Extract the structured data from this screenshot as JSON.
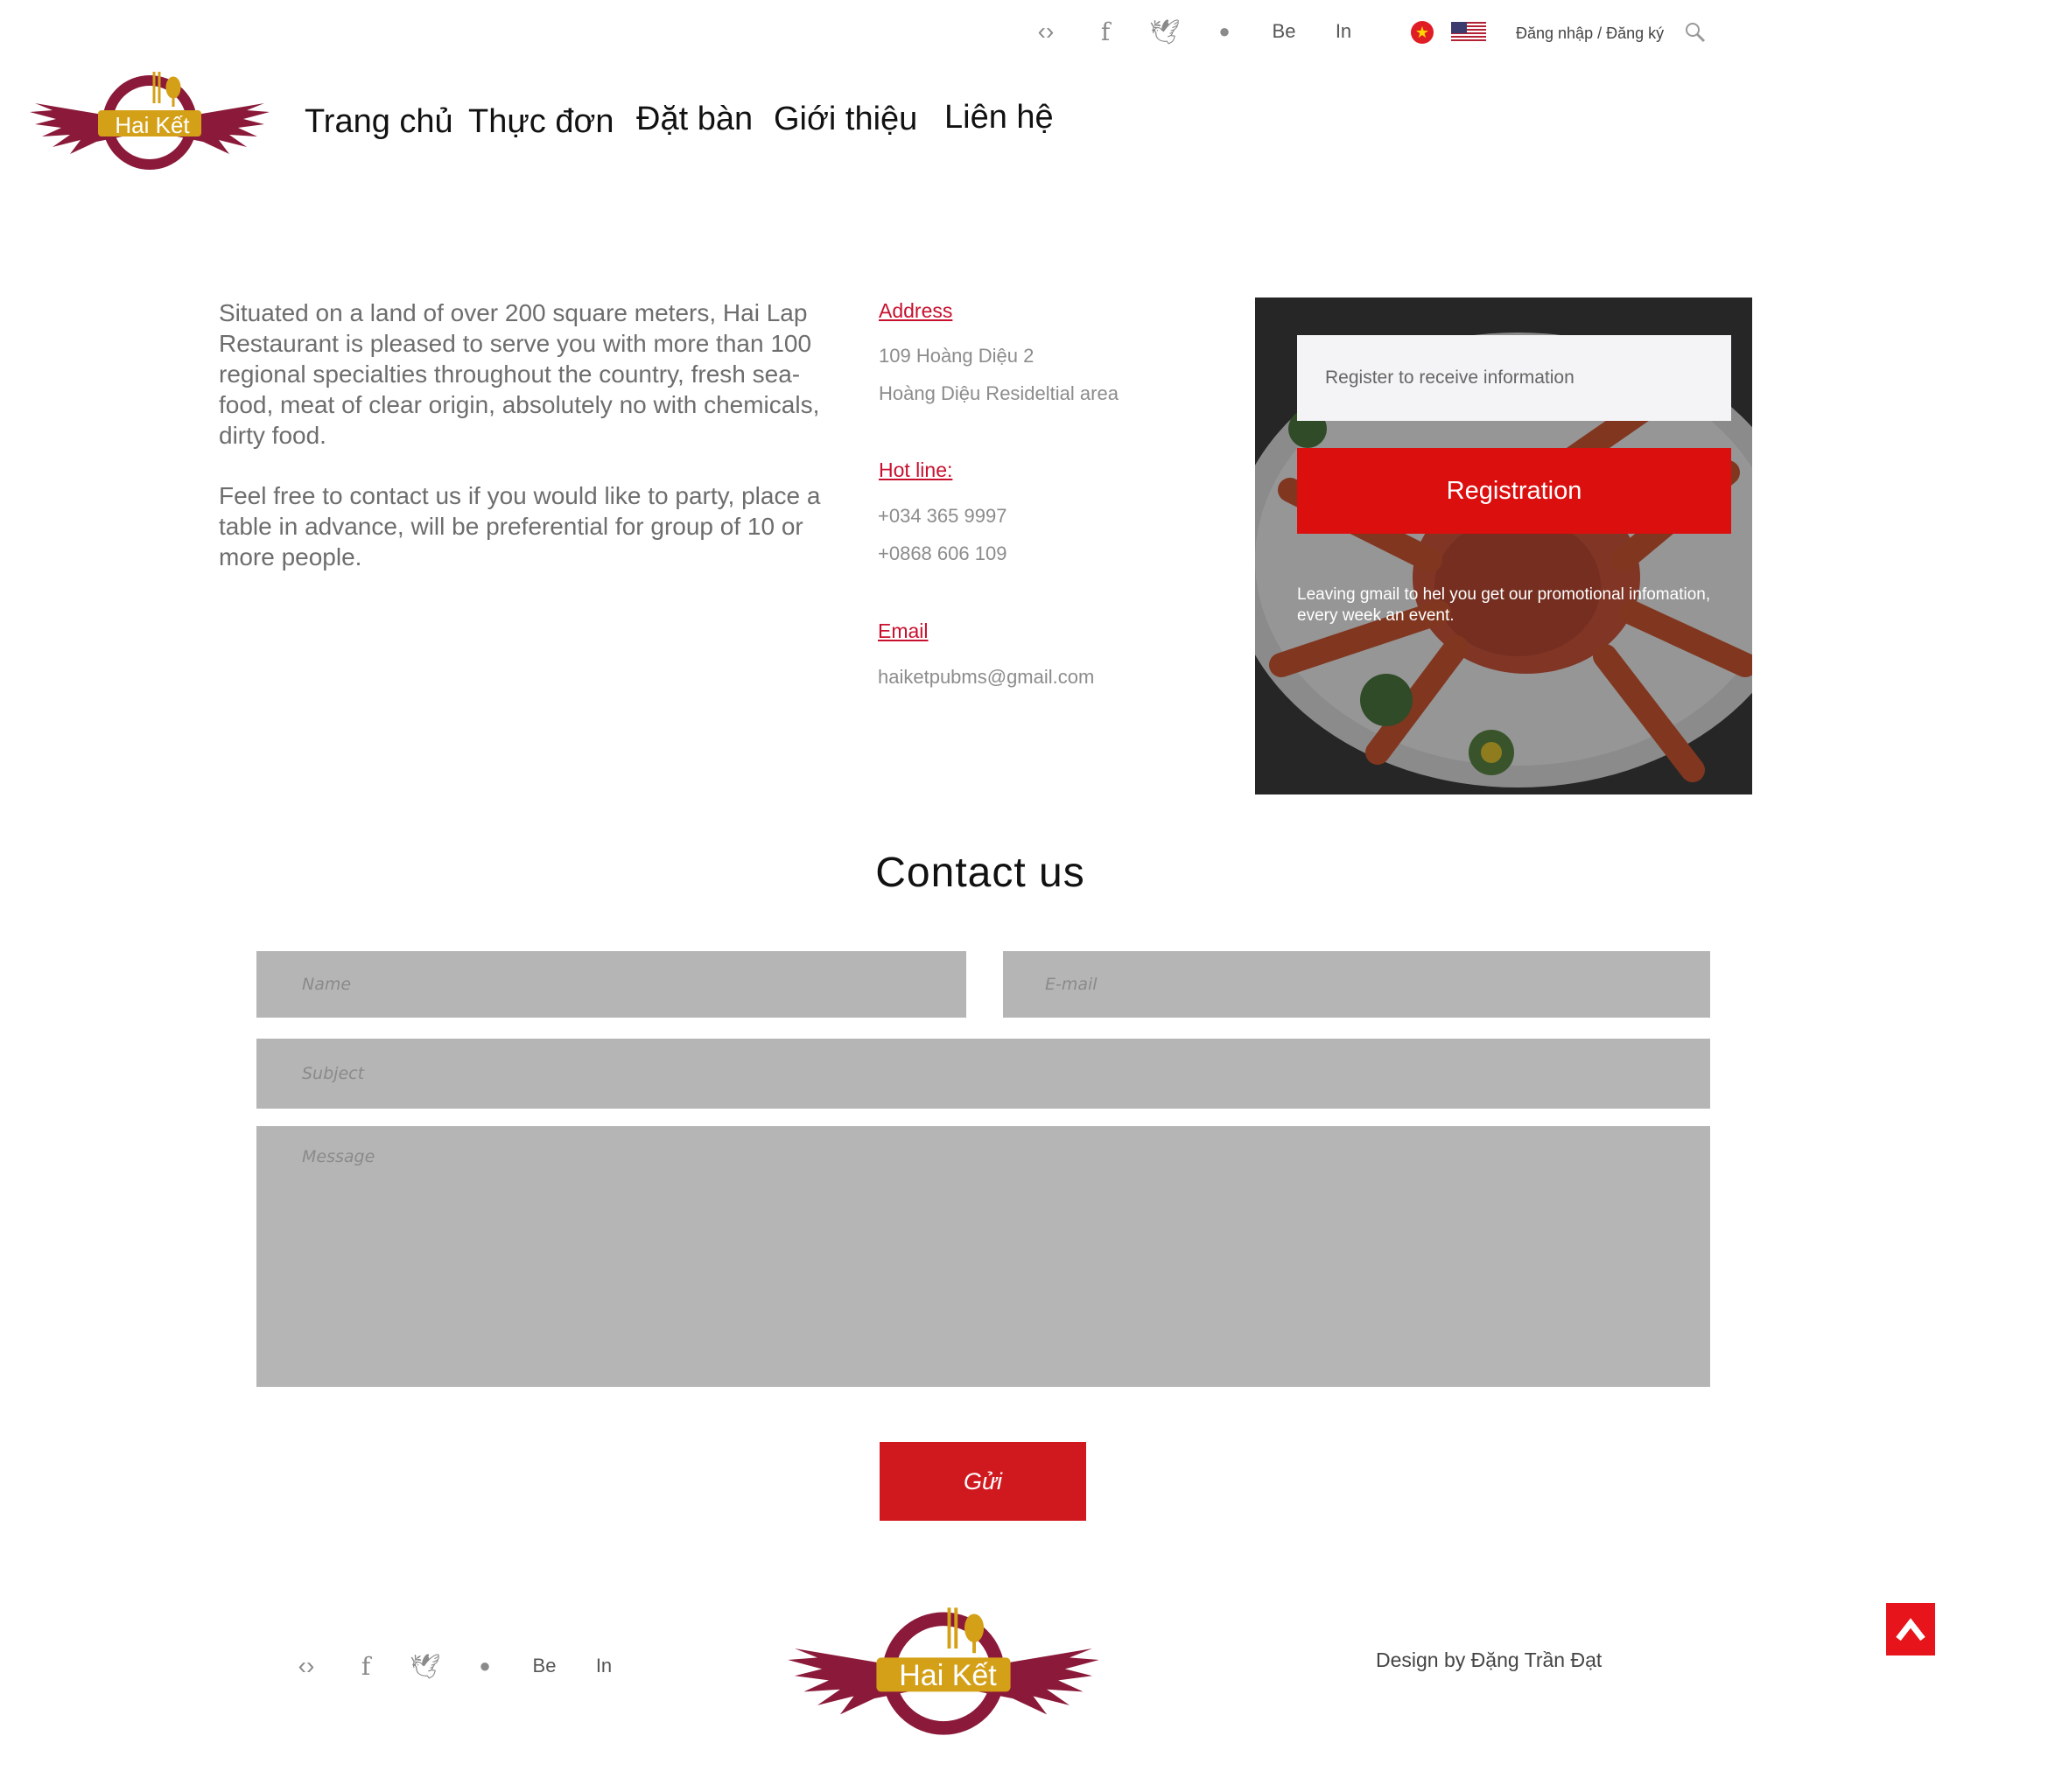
{
  "top": {
    "social": [
      {
        "icon": "eye-icon",
        "glyph": "‹›"
      },
      {
        "icon": "facebook-icon",
        "glyph": "f"
      },
      {
        "icon": "bird-icon",
        "glyph": "🕊"
      },
      {
        "icon": "dribbble-icon",
        "glyph": "●"
      },
      {
        "icon": "behance-icon",
        "text": "Be"
      },
      {
        "icon": "linkedin-icon",
        "text": "In"
      }
    ],
    "login_label": "Đăng nhập / Đăng ký"
  },
  "logo": {
    "text": "Hai Kết"
  },
  "nav": [
    {
      "label": "Trang chủ"
    },
    {
      "label": "Thực đơn"
    },
    {
      "label": "Đặt bàn"
    },
    {
      "label": "Giới thiệu"
    },
    {
      "label": "Liên hệ"
    }
  ],
  "about": {
    "p1": "Situated on a land of over 200 square meters, Hai Lap Restaurant is pleased to serve you with more than 100 regional specialties throughout the country, fresh sea-food, meat of clear origin, absolutely no with chemicals, dirty food.",
    "p2": "Feel free to contact us if you would like to party, place a table in advance, will be preferential for group of 10 or more people."
  },
  "info": {
    "address_label": "Address",
    "address_line1": "109 Hoàng Diệu 2",
    "address_line2": "Hoàng Diệu Resideltial area",
    "hotline_label": "Hot line:",
    "phone1": "+034 365 9997",
    "phone2": "+0868 606 109",
    "email_label": "Email",
    "email": "haiketpubms@gmail.com"
  },
  "register": {
    "placeholder": "Register to receive information",
    "button": "Registration",
    "note": "Leaving gmail to hel you get our promotional infomation, every week an event."
  },
  "contact": {
    "title": "Contact us",
    "name_ph": "Name",
    "email_ph": "E-mail",
    "subject_ph": "Subject",
    "message_ph": "Message",
    "send": "Gửi"
  },
  "footer": {
    "credit": "Design by Đặng Trần Đạt"
  },
  "colors": {
    "accent": "#c8102e",
    "button_red": "#dc0f0f",
    "field_gray": "#b5b5b5",
    "logo_red": "#8b1a3a",
    "logo_gold": "#d4a017"
  }
}
